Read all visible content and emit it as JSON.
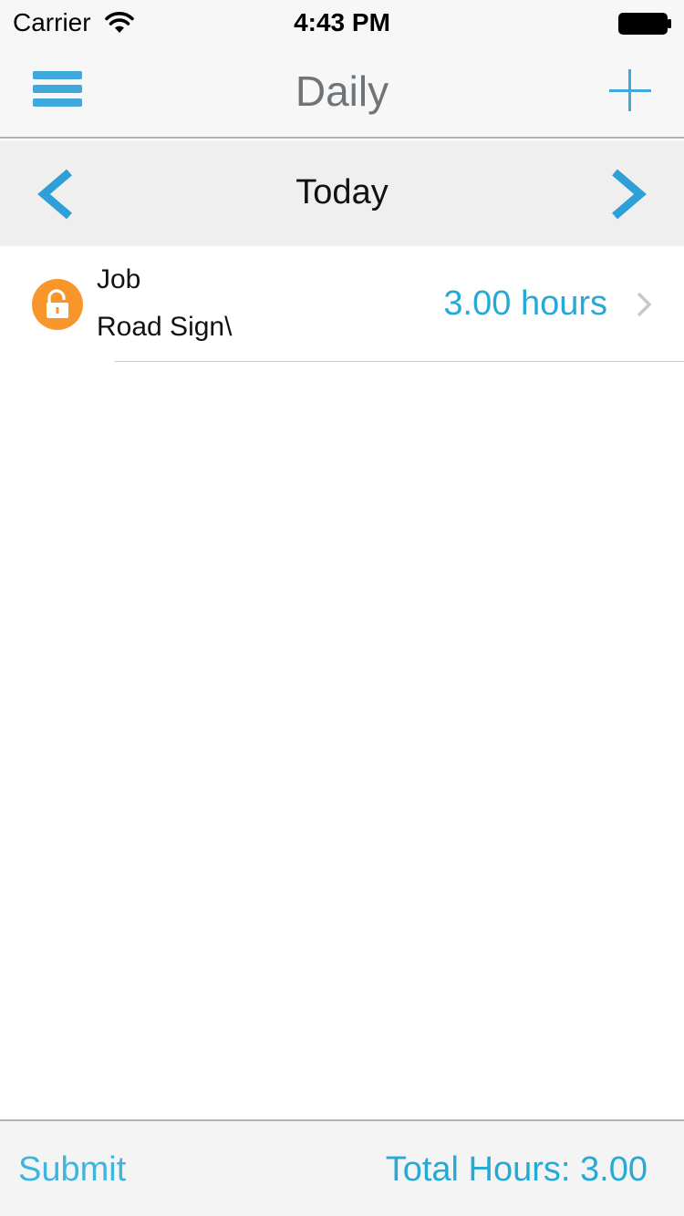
{
  "status_bar": {
    "carrier": "Carrier",
    "time": "4:43 PM",
    "icons": [
      "wifi-icon",
      "battery-icon"
    ]
  },
  "nav": {
    "title": "Daily",
    "left_icon": "menu-icon",
    "right_icon": "plus-icon"
  },
  "date_selector": {
    "label": "Today",
    "prev_icon": "chevron-left-icon",
    "next_icon": "chevron-right-icon"
  },
  "entries": [
    {
      "label": "Job",
      "job": "Road Sign\\",
      "hours": "3.00 hours",
      "status_icon": "unlocked-icon"
    }
  ],
  "toolbar": {
    "submit_label": "Submit",
    "total_label": "Total Hours: 3.00"
  },
  "colors": {
    "accent": "#3fa9dc",
    "hours_text": "#27a9d6",
    "status_badge": "#f9962b",
    "nav_title": "#6f7478"
  }
}
